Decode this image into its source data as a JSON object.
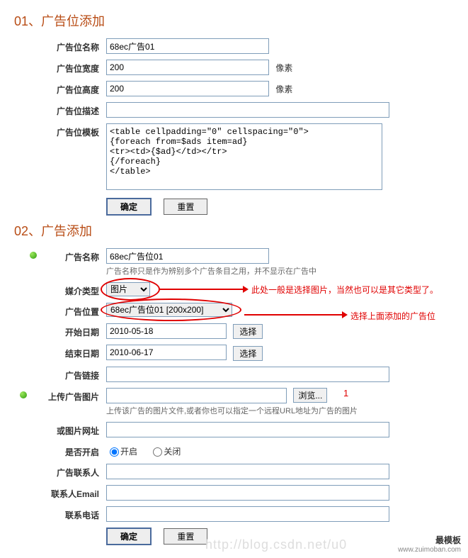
{
  "section1": {
    "title": "01、广告位添加",
    "fields": {
      "name_label": "广告位名称",
      "name_value": "68ec广告01",
      "width_label": "广告位宽度",
      "width_value": "200",
      "width_unit": "像素",
      "height_label": "广告位高度",
      "height_value": "200",
      "height_unit": "像素",
      "desc_label": "广告位描述",
      "desc_value": "",
      "tpl_label": "广告位模板",
      "tpl_value": "<table cellpadding=\"0\" cellspacing=\"0\">\n{foreach from=$ads item=ad}\n<tr><td>{$ad}</td></tr>\n{/foreach}\n</table>"
    },
    "buttons": {
      "submit": "确定",
      "reset": "重置"
    }
  },
  "section2": {
    "title": "02、广告添加",
    "fields": {
      "name_label": "广告名称",
      "name_value": "68ec广告位01",
      "name_hint": "广告名称只是作为辨别多个广告条目之用，并不显示在广告中",
      "media_label": "媒介类型",
      "media_value": "图片",
      "position_label": "广告位置",
      "position_value": "68ec广告位01 [200x200]",
      "start_label": "开始日期",
      "start_value": "2010-05-18",
      "end_label": "结束日期",
      "end_value": "2010-06-17",
      "link_label": "广告链接",
      "link_value": "",
      "upload_label": "上传广告图片",
      "upload_hint": "上传该广告的图片文件,或者你也可以指定一个远程URL地址为广告的图片",
      "imgurl_label": "或图片网址",
      "imgurl_value": "",
      "enabled_label": "是否开启",
      "enabled_on": "开启",
      "enabled_off": "关闭",
      "contact_label": "广告联系人",
      "contact_value": "",
      "email_label": "联系人Email",
      "email_value": "",
      "phone_label": "联系电话",
      "phone_value": ""
    },
    "buttons": {
      "select": "选择",
      "browse": "浏览...",
      "submit": "确定",
      "reset": "重置"
    }
  },
  "annotations": {
    "media_note": "此处一般是选择图片，当然也可以是其它类型了。",
    "position_note": "选择上面添加的广告位",
    "num1": "1"
  },
  "watermark": "http://blog.csdn.net/u0",
  "footer": {
    "cn": "最模板",
    "en": "www.zuimoban.com"
  }
}
